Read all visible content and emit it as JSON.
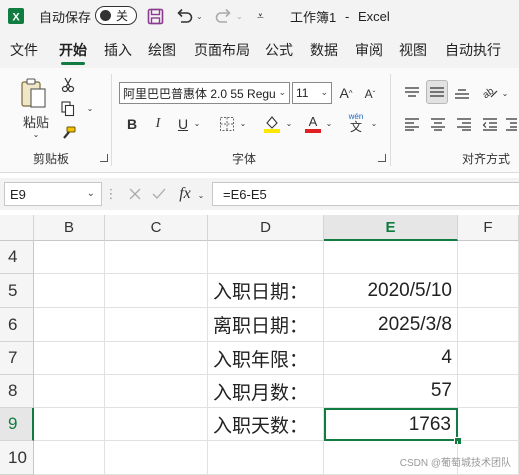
{
  "titlebar": {
    "autosave_label": "自动保存",
    "toggle_state": "关",
    "doc_title": "工作簿1",
    "separator": "-",
    "app_name": "Excel"
  },
  "tabs": [
    "文件",
    "开始",
    "插入",
    "绘图",
    "页面布局",
    "公式",
    "数据",
    "审阅",
    "视图",
    "自动执行"
  ],
  "active_tab": "开始",
  "ribbon": {
    "clipboard": {
      "paste_label": "粘贴",
      "group_label": "剪贴板"
    },
    "font": {
      "font_name": "阿里巴巴普惠体 2.0 55 Regu",
      "font_size": "11",
      "bold": "B",
      "italic": "I",
      "underline": "U",
      "font_color_glyph": "A",
      "pinyin_top": "wén",
      "pinyin_bottom": "文",
      "group_label": "字体"
    },
    "alignment": {
      "group_label": "对齐方式"
    }
  },
  "formula_bar": {
    "name_box": "E9",
    "formula": "=E6-E5"
  },
  "grid": {
    "columns": [
      "B",
      "C",
      "D",
      "E",
      "F"
    ],
    "selected_column": "E",
    "rows": [
      {
        "num": "4",
        "d": "",
        "e": ""
      },
      {
        "num": "5",
        "d": "入职日期：",
        "e": "2020/5/10"
      },
      {
        "num": "6",
        "d": "离职日期：",
        "e": "2025/3/8"
      },
      {
        "num": "7",
        "d": "入职年限：",
        "e": "4"
      },
      {
        "num": "8",
        "d": "入职月数：",
        "e": "57"
      },
      {
        "num": "9",
        "d": "入职天数：",
        "e": "1763"
      },
      {
        "num": "10",
        "d": "",
        "e": ""
      }
    ],
    "active_cell": "E9"
  },
  "watermark": "CSDN @葡萄城技术团队",
  "colors": {
    "accent": "#107c41",
    "highlight": "#ffe600",
    "font_color": "#e02020",
    "save_icon": "#8b3a8f"
  }
}
